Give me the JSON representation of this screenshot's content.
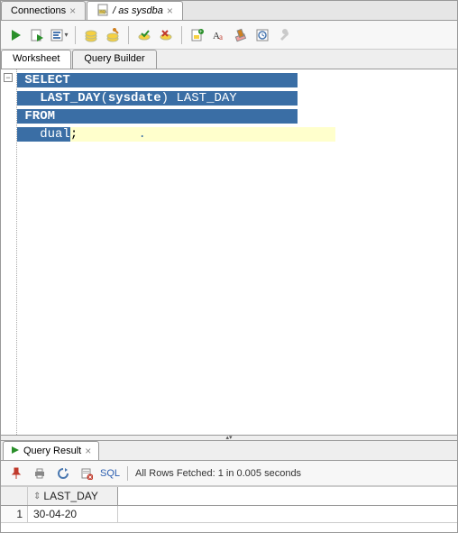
{
  "top_tabs": {
    "connections": "Connections",
    "session": "/ as sysdba"
  },
  "sub_tabs": {
    "worksheet": "Worksheet",
    "query_builder": "Query Builder"
  },
  "sql": {
    "line1a": "SELECT",
    "line2_indent": "  ",
    "line2_fn": "LAST_DAY",
    "line2_paren_open": "(",
    "line2_arg": "sysdate",
    "line2_paren_close": ")",
    "line2_alias": " LAST_DAY",
    "line3": "FROM",
    "line4_indent": "  ",
    "line4_tbl": "dual",
    "line4_semi": ";"
  },
  "result_tab": "Query Result",
  "sql_link": "SQL",
  "status": "All Rows Fetched: 1 in 0.005 seconds",
  "grid": {
    "col1_header": "LAST_DAY",
    "row1_num": "1",
    "row1_col1": "30-04-20"
  }
}
